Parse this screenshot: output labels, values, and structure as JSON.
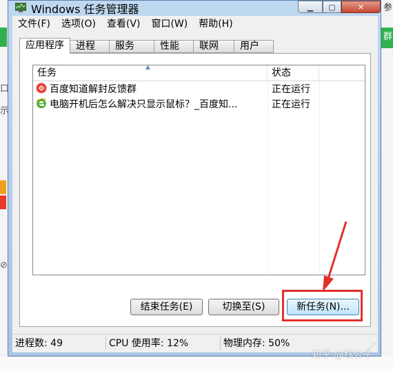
{
  "window": {
    "title": "Windows 任务管理器"
  },
  "menu": [
    "文件(F)",
    "选项(O)",
    "查看(V)",
    "窗口(W)",
    "帮助(H)"
  ],
  "tabs": [
    "应用程序",
    "进程",
    "服务",
    "性能",
    "联网",
    "用户"
  ],
  "active_tab": 0,
  "list": {
    "columns": [
      "任务",
      "状态"
    ],
    "rows": [
      {
        "icon": "baidu-zhidao-icon",
        "name": "百度知道解封反馈群",
        "status": "正在运行"
      },
      {
        "icon": "ie-browser-icon",
        "name": "电脑开机后怎么解决只显示鼠标？_百度知...",
        "status": "正在运行"
      }
    ]
  },
  "buttons": {
    "end_task": "结束任务(E)",
    "switch_to": "切换至(S)",
    "new_task": "新任务(N)..."
  },
  "status": {
    "processes": "进程数: 49",
    "cpu": "CPU 使用率: 12%",
    "memory": "物理内存: 50%"
  },
  "background": {
    "left_glyphs": [
      "示",
      "口",
      "⊘"
    ],
    "right_text_top": "参",
    "right_text_green": "群"
  },
  "watermark": "知乎 @钰公子",
  "colors": {
    "highlight": "#e0302a",
    "title_bar": "#bfd8f0",
    "close_button": "#c44a33"
  }
}
